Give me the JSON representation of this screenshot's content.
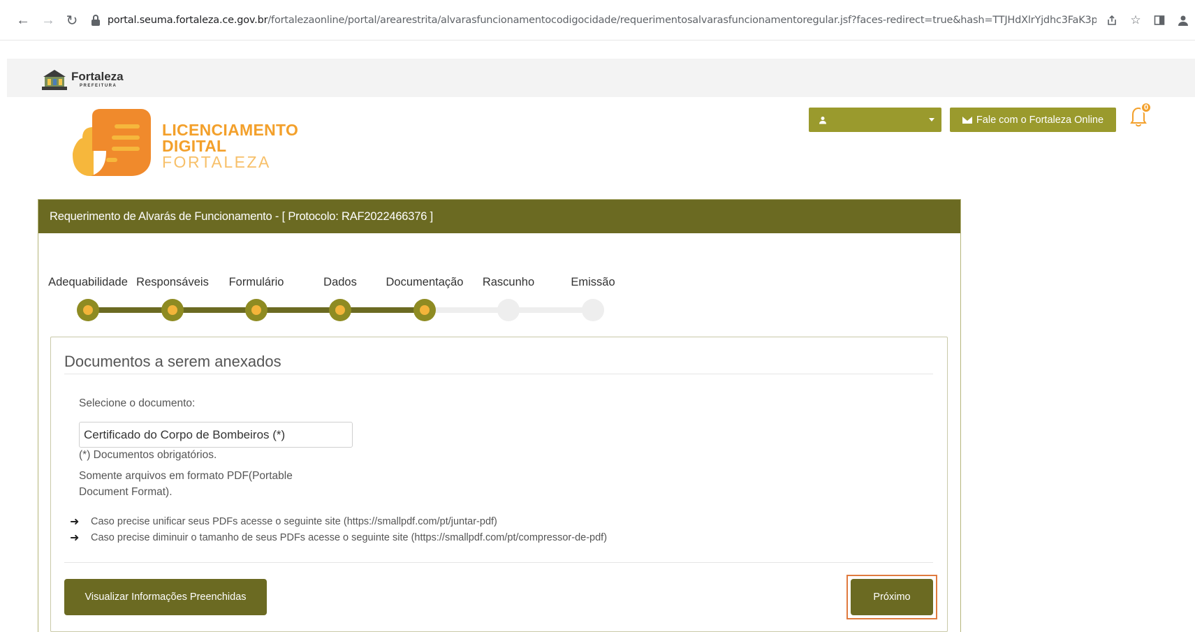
{
  "browser": {
    "url_host": "portal.seuma.fortaleza.ce.gov.br",
    "url_path": "/fortalezaonline/portal/arearestrita/alvarasfuncionamentocodigocidade/requerimentosalvarasfuncionamentoregular.jsf?faces-redirect=true&hash=TTJHdXlrYjdhc3FaK3p..."
  },
  "gov_header": {
    "brand_name": "Fortaleza",
    "brand_sub": "PREFEITURA"
  },
  "lic_logo": {
    "line1": "LICENCIAMENTO",
    "line2": "DIGITAL",
    "line3": "FORTALEZA"
  },
  "top_actions": {
    "contact_label": "Fale com o Fortaleza Online",
    "notification_count": "0"
  },
  "panel": {
    "title": "Requerimento de Alvarás de Funcionamento - [ Protocolo: RAF2022466376 ]"
  },
  "stepper": {
    "steps": [
      {
        "label": "Adequabilidade",
        "done": true
      },
      {
        "label": "Responsáveis",
        "done": true
      },
      {
        "label": "Formulário",
        "done": true
      },
      {
        "label": "Dados",
        "done": true
      },
      {
        "label": "Documentação",
        "done": true
      },
      {
        "label": "Rascunho",
        "done": false
      },
      {
        "label": "Emissão",
        "done": false
      }
    ]
  },
  "docs": {
    "title": "Documentos a serem anexados",
    "select_label": "Selecione o documento:",
    "selected_document": "Certificado do Corpo de Bombeiros (*)",
    "mandatory_note": "(*) Documentos obrigatórios.",
    "pdf_note": "Somente arquivos em formato PDF(Portable Document Format).",
    "hints": [
      "Caso precise unificar seus PDFs acesse o seguinte site (https://smallpdf.com/pt/juntar-pdf)",
      "Caso precise diminuir o tamanho de seus PDFs acesse o seguinte site (https://smallpdf.com/pt/compressor-de-pdf)"
    ]
  },
  "buttons": {
    "view_label": "Visualizar Informações Preenchidas",
    "next_label": "Próximo"
  },
  "colors": {
    "olive_dark": "#6b6a22",
    "olive_light": "#9a9a2d",
    "orange": "#f3a02b",
    "highlight": "#e07a3e"
  }
}
